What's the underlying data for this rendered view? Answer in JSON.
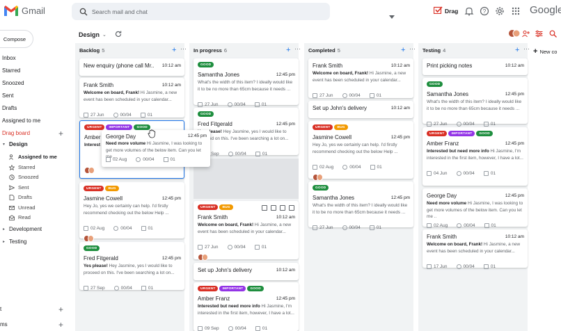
{
  "app": {
    "name": "Gmail",
    "brand": "Google"
  },
  "search": {
    "placeholder": "Search mail and chat"
  },
  "header": {
    "drag_label": "Drag"
  },
  "sidebar": {
    "compose_label": "Compose",
    "items": [
      {
        "label": "Inbox"
      },
      {
        "label": "Starred"
      },
      {
        "label": "Snoozed"
      },
      {
        "label": "Sent"
      },
      {
        "label": "Drafts"
      },
      {
        "label": "Assigned to me"
      },
      {
        "label": "Drag board"
      },
      {
        "label": "Design"
      }
    ],
    "design_subitems": [
      {
        "label": "Assigned to me",
        "icon": "people-icon"
      },
      {
        "label": "Starred",
        "icon": "star-icon"
      },
      {
        "label": "Snoozed",
        "icon": "clock-icon"
      },
      {
        "label": "Sent",
        "icon": "send-icon"
      },
      {
        "label": "Drafts",
        "icon": "draft-icon"
      },
      {
        "label": "Unread",
        "icon": "mail-icon"
      },
      {
        "label": "Read",
        "icon": "mail-open-icon"
      }
    ],
    "groups": [
      {
        "label": "Development"
      },
      {
        "label": "Testing"
      }
    ],
    "footer": [
      {
        "label": "t"
      },
      {
        "label": "ms"
      }
    ]
  },
  "board": {
    "title": "Design"
  },
  "columns": [
    {
      "name": "Backlog",
      "count": "5"
    },
    {
      "name": "In progress",
      "count": "6"
    },
    {
      "name": "Completed",
      "count": "5"
    },
    {
      "name": "Testing",
      "count": "4"
    },
    {
      "name": "New co"
    }
  ],
  "tag_colors": {
    "URGENT": "#d93025",
    "IMPORTANT": "#9334e6",
    "BUG": "#f29900",
    "GOOD": "#1e8e3e"
  },
  "cards": {
    "b1": {
      "title": "New enquiry (phone call Mr..",
      "time": "10:12 am"
    },
    "b2": {
      "title": "Frank Smith",
      "time": "10:12 am",
      "bold": "Welcome on board, Frank!",
      "text": " Hi Jasmine, a new event has been scheduled in your calendar...",
      "date": "27 Jun",
      "progress": "00/04",
      "attach": "01"
    },
    "b3": {
      "tags": [
        "URGENT",
        "IMPORTANT",
        "GOOD"
      ],
      "title": "Amber",
      "bold": "Interest",
      "text": "",
      "time": "12:45 pm"
    },
    "b4": {
      "tags": [
        "URGENT",
        "BUG"
      ],
      "title": "Jasmine Cowell",
      "time": "12:45 pm",
      "text": "Hey Jo, yes we certainly can help. I'd firstly recommend checking out the below Help ...",
      "date": "02 Aug",
      "progress": "00/04",
      "attach": "01"
    },
    "b5": {
      "tags": [
        "GOOD"
      ],
      "title": "Fred Fitgerald",
      "time": "12:45 pm",
      "bold": "Yes please!",
      "text": " Hey Jasmine, yes I would like to proceed on this. I've been searching a lot on...",
      "date": "27 Sep",
      "progress": "00/04",
      "attach": "01"
    },
    "popup": {
      "title": "George Day",
      "time": "12:45 pm",
      "bold": "Need more volume",
      "text": " Hi Jasmine, I was looking to get more volumes of the below item. Can you let me ..",
      "date": "02 Aug",
      "progress": "00/04",
      "attach": "01"
    },
    "p1": {
      "tags": [
        "GOOD"
      ],
      "title": "Samantha Jones",
      "time": "12:45 pm",
      "text": "What's the width of this item? I ideally would like it to be no more than 65cm because it needs ...",
      "date": "27 Jun",
      "progress": "00/04",
      "attach": "01"
    },
    "p2": {
      "tags": [
        "GOOD"
      ],
      "title": "Fred Fitgerald",
      "time": "12:45 pm",
      "bold": "Yes please!",
      "text": " Hey Jasmine, yes I would like to proceed on this. I've been searching a lot on...",
      "date": "27 Sep",
      "progress": "00/04",
      "attach": "01"
    },
    "p3": {
      "tags": [
        "URGENT",
        "BUG"
      ],
      "title": "Frank Smith",
      "time": "10:12 am",
      "bold": "Welcome on board, Frank!",
      "text": " Hi Jasmine, a new event has been scheduled in your calendar...",
      "date": "27 Jun",
      "progress": "00/04",
      "attach": "01"
    },
    "p4": {
      "title": "Set up John's delivery",
      "time": "10:12 am"
    },
    "p5": {
      "tags": [
        "URGENT",
        "IMPORTANT",
        "GOOD"
      ],
      "title": "Amber Franz",
      "time": "12:45 pm",
      "bold": "Interested but need more info",
      "text": " Hi Jasmine, I'm interested in the first item, however, I have a lot...",
      "date": "09 Sep",
      "progress": "00/04",
      "attach": "01"
    },
    "c1": {
      "title": "Frank Smith",
      "time": "10:12 am",
      "bold": "Welcome on board, Frank!",
      "text": " Hi Jasmine, a new event has been scheduled in your calendar...",
      "date": "27 Jun",
      "progress": "00/04",
      "attach": "01"
    },
    "c2": {
      "title": "Set up John's delivery",
      "time": "10:12 am"
    },
    "c3": {
      "tags": [
        "URGENT",
        "BUG"
      ],
      "title": "Jasmine Cowell",
      "time": "12:45 pm",
      "text": "Hey Jo, yes we certainly can help. I'd firstly recommend checking out the below Help ...",
      "date": "02 Aug",
      "progress": "00/04",
      "attach": "01"
    },
    "c4": {
      "tags": [
        "GOOD"
      ],
      "title": "Samantha Jones",
      "time": "12:45 pm",
      "text": "What's the width of this item? I ideally would like it to be no more than 65cm because it needs ...",
      "date": "27 Jun",
      "progress": "00/04",
      "attach": "01"
    },
    "t1": {
      "title": "Print picking notes",
      "time": "10:12 am"
    },
    "t2": {
      "tags": [
        "GOOD"
      ],
      "title": "Samantha Jones",
      "time": "12:45 pm",
      "text": "What's the width of this item? I ideally would like it to be no more than 65cm because it needs ...",
      "date": "27 Jun",
      "progress": "00/04",
      "attach": "01"
    },
    "t3": {
      "tags": [
        "URGENT",
        "IMPORTANT",
        "GOOD"
      ],
      "title": "Amber Franz",
      "time": "12:45 pm",
      "bold": "Interested but need more info",
      "text": " Hi Jasmine, I'm interested in the first item, however, I have a lot...",
      "date": "04 Jun",
      "progress": "00/04",
      "attach": "01"
    },
    "t4": {
      "title": "George Day",
      "time": "12:45 pm",
      "bold": "Need more volume",
      "text": " Hi Jasmine, I was looking to get more volumes of the below item. Can you let me ..",
      "date": "02 Aug",
      "progress": "00/04",
      "attach": "01"
    },
    "t5": {
      "title": "Frank Smith",
      "time": "10:12 am",
      "bold": "Welcome on board, Frank!",
      "text": " Hi Jasmine, a new event has been scheduled in your calendar...",
      "date": "17 Jun",
      "progress": "00/04",
      "attach": "01"
    }
  }
}
